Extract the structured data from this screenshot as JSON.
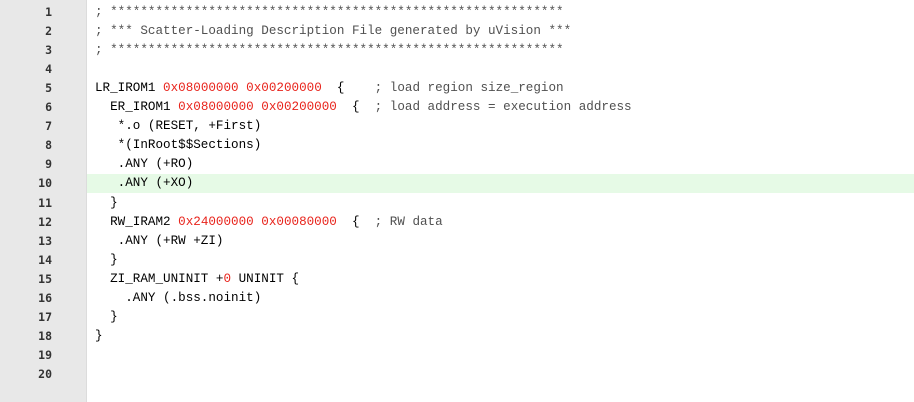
{
  "editor": {
    "highlighted_line": 10,
    "lines": [
      {
        "num": "1",
        "parts": [
          {
            "t": "; ************************************************************",
            "c": "comment"
          }
        ]
      },
      {
        "num": "2",
        "parts": [
          {
            "t": "; *** Scatter-Loading Description File generated by uVision ***",
            "c": "comment"
          }
        ]
      },
      {
        "num": "3",
        "parts": [
          {
            "t": "; ************************************************************",
            "c": "comment"
          }
        ]
      },
      {
        "num": "4",
        "parts": []
      },
      {
        "num": "5",
        "parts": [
          {
            "t": "LR_IROM1 ",
            "c": "kw"
          },
          {
            "t": "0x08000000",
            "c": "num"
          },
          {
            "t": " ",
            "c": "kw"
          },
          {
            "t": "0x00200000",
            "c": "num"
          },
          {
            "t": "  {    ",
            "c": "kw"
          },
          {
            "t": "; load region size_region",
            "c": "comment"
          }
        ]
      },
      {
        "num": "6",
        "parts": [
          {
            "t": "  ER_IROM1 ",
            "c": "kw"
          },
          {
            "t": "0x08000000",
            "c": "num"
          },
          {
            "t": " ",
            "c": "kw"
          },
          {
            "t": "0x00200000",
            "c": "num"
          },
          {
            "t": "  {  ",
            "c": "kw"
          },
          {
            "t": "; load address = execution address",
            "c": "comment"
          }
        ]
      },
      {
        "num": "7",
        "parts": [
          {
            "t": "   *.o (RESET, +First)",
            "c": "kw"
          }
        ]
      },
      {
        "num": "8",
        "parts": [
          {
            "t": "   *(InRoot$$Sections)",
            "c": "kw"
          }
        ]
      },
      {
        "num": "9",
        "parts": [
          {
            "t": "   .ANY (+RO)",
            "c": "kw"
          }
        ]
      },
      {
        "num": "10",
        "parts": [
          {
            "t": "   .ANY (+XO)",
            "c": "kw"
          }
        ]
      },
      {
        "num": "11",
        "parts": [
          {
            "t": "  }",
            "c": "kw"
          }
        ]
      },
      {
        "num": "12",
        "parts": [
          {
            "t": "  RW_IRAM2 ",
            "c": "kw"
          },
          {
            "t": "0x24000000",
            "c": "num"
          },
          {
            "t": " ",
            "c": "kw"
          },
          {
            "t": "0x00080000",
            "c": "num"
          },
          {
            "t": "  {  ",
            "c": "kw"
          },
          {
            "t": "; RW data",
            "c": "comment"
          }
        ]
      },
      {
        "num": "13",
        "parts": [
          {
            "t": "   .ANY (+RW +ZI)",
            "c": "kw"
          }
        ]
      },
      {
        "num": "14",
        "parts": [
          {
            "t": "  }",
            "c": "kw"
          }
        ]
      },
      {
        "num": "15",
        "parts": [
          {
            "t": "  ZI_RAM_UNINIT +",
            "c": "kw"
          },
          {
            "t": "0",
            "c": "num"
          },
          {
            "t": " UNINIT {",
            "c": "kw"
          }
        ]
      },
      {
        "num": "16",
        "parts": [
          {
            "t": "    .ANY (.bss.noinit)",
            "c": "kw"
          }
        ]
      },
      {
        "num": "17",
        "parts": [
          {
            "t": "  }",
            "c": "kw"
          }
        ]
      },
      {
        "num": "18",
        "parts": [
          {
            "t": "}",
            "c": "kw"
          }
        ]
      },
      {
        "num": "19",
        "parts": []
      },
      {
        "num": "20",
        "parts": []
      }
    ]
  }
}
